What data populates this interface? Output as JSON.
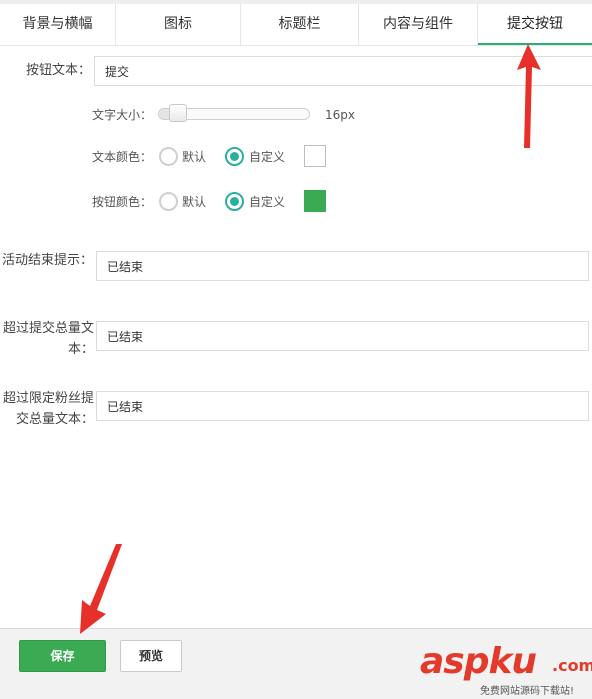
{
  "tabs": [
    {
      "label": "背景与横幅"
    },
    {
      "label": "图标"
    },
    {
      "label": "标题栏"
    },
    {
      "label": "内容与组件"
    },
    {
      "label": "提交按钮",
      "active": true
    }
  ],
  "form": {
    "button_text": {
      "label": "按钮文本：",
      "value": "提交"
    },
    "text_size": {
      "label": "文字大小：",
      "value_text": "16px",
      "level_fraction": 0.08
    },
    "text_color": {
      "label": "文本颜色：",
      "option_default": "默认",
      "option_custom": "自定义",
      "selected": "custom",
      "color": "#ffffff"
    },
    "button_color": {
      "label": "按钮颜色：",
      "option_default": "默认",
      "option_custom": "自定义",
      "selected": "custom",
      "color": "#3aaa53"
    },
    "end_tip": {
      "label": "活动结束提示：",
      "value": "已结束"
    },
    "over_total": {
      "label_line1": "超过提交总量文",
      "label_line2": "本：",
      "value": "已结束"
    },
    "over_fans": {
      "label_line1": "超过限定粉丝提",
      "label_line2": "交总量文本：",
      "value": "已结束"
    }
  },
  "footer": {
    "save_label": "保存",
    "preview_label": "预览"
  },
  "watermark": {
    "logo_text": "aspku",
    "logo_suffix": ".com",
    "tagline": "免费网站源码下载站!"
  },
  "colors": {
    "accent": "#2aaf72",
    "radio": "#2aaf9f",
    "save_button": "#3aaa53",
    "arrow": "#e8302a"
  }
}
